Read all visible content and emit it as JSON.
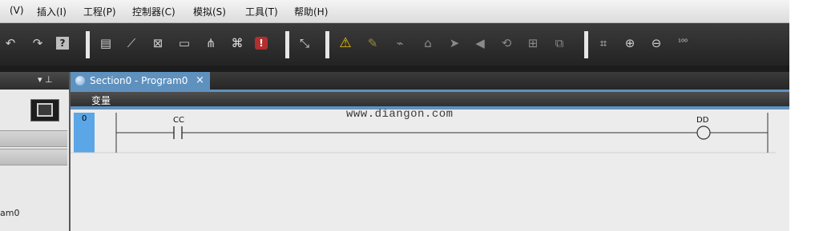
{
  "menu": {
    "items": [
      {
        "label": "(V)"
      },
      {
        "label": "插入(I)"
      },
      {
        "label": "工程(P)"
      },
      {
        "label": "控制器(C)"
      },
      {
        "label": "模拟(S)"
      },
      {
        "label": "工具(T)"
      },
      {
        "label": "帮助(H)"
      }
    ]
  },
  "toolbar": {
    "icons": [
      {
        "name": "undo-icon",
        "glyph": "↶"
      },
      {
        "name": "redo-icon",
        "glyph": "↷"
      },
      {
        "name": "help-icon",
        "glyph": "?"
      },
      {
        "name": "properties-icon",
        "glyph": "▤"
      },
      {
        "name": "wire-tool-icon",
        "glyph": "⟋"
      },
      {
        "name": "cross-reference-icon",
        "glyph": "⊠"
      },
      {
        "name": "edit-variable-icon",
        "glyph": "▭"
      },
      {
        "name": "network-icon",
        "glyph": "⋔"
      },
      {
        "name": "find-icon",
        "glyph": "⌘"
      },
      {
        "name": "error-icon",
        "glyph": "!"
      },
      {
        "name": "build-icon",
        "glyph": "⤡"
      },
      {
        "name": "warning-icon",
        "glyph": "⚠"
      },
      {
        "name": "disable-icon",
        "glyph": "✎"
      },
      {
        "name": "online-icon",
        "glyph": "⌁"
      },
      {
        "name": "offline-icon",
        "glyph": "⌂"
      },
      {
        "name": "transfer-to-icon",
        "glyph": "➤"
      },
      {
        "name": "transfer-from-icon",
        "glyph": "◀"
      },
      {
        "name": "synchronize-icon",
        "glyph": "⟲"
      },
      {
        "name": "monitor-icon",
        "glyph": "⊞"
      },
      {
        "name": "compare-icon",
        "glyph": "⧉"
      },
      {
        "name": "fit-icon",
        "glyph": "⌗"
      },
      {
        "name": "zoom-in-icon",
        "glyph": "⊕"
      },
      {
        "name": "zoom-out-icon",
        "glyph": "⊖"
      },
      {
        "name": "zoom-100-icon",
        "glyph": "¹⁰⁰"
      }
    ]
  },
  "left_panel": {
    "pin_glyph": "▾ ⊥",
    "item_label": "am0"
  },
  "editor": {
    "tab_label": "Section0 - Program0",
    "tab_close": "×",
    "variables_header": "变量",
    "rung_number": "0",
    "watermark": "www.diangon.com",
    "contact_variable": "CC",
    "coil_variable": "DD"
  },
  "colors": {
    "accent": "#5f91bf",
    "rung_marker": "#5aa6e6",
    "warning": "#f2c200"
  }
}
